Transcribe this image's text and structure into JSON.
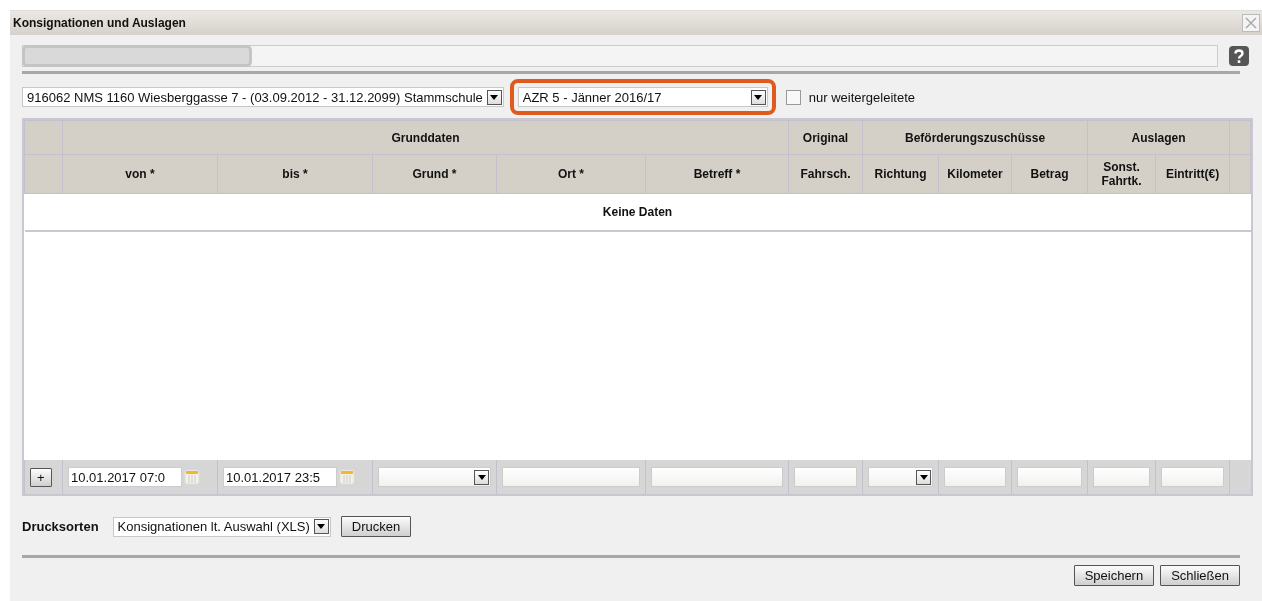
{
  "window": {
    "title": "Konsignationen und Auslagen"
  },
  "filters": {
    "school_select": {
      "value": "916062 NMS 1160 Wiesberggasse 7 - (03.09.2012 - 31.12.2099) Stammschule"
    },
    "period_select": {
      "value": "AZR 5 - Jänner 2016/17",
      "highlighted": true
    },
    "forwarded_checkbox": {
      "label": "nur weitergeleitete",
      "checked": false
    }
  },
  "table": {
    "groups": [
      "Grunddaten",
      "Original",
      "Beförderungszuschüsse",
      "Auslagen"
    ],
    "columns": [
      "von *",
      "bis *",
      "Grund *",
      "Ort *",
      "Betreff *",
      "Fahrsch.",
      "Richtung",
      "Kilometer",
      "Betrag",
      "Sonst. Fahrtk.",
      "Eintritt(€)"
    ],
    "empty_message": "Keine Daten",
    "add_button": "+",
    "input_row": [
      {
        "kind": "date",
        "value": "10.01.2017 07:0"
      },
      {
        "kind": "date",
        "value": "10.01.2017 23:5"
      },
      {
        "kind": "select"
      },
      {
        "kind": "text"
      },
      {
        "kind": "text"
      },
      {
        "kind": "text"
      },
      {
        "kind": "select"
      },
      {
        "kind": "text"
      },
      {
        "kind": "text"
      },
      {
        "kind": "text"
      },
      {
        "kind": "text"
      }
    ]
  },
  "print": {
    "label": "Drucksorten",
    "select": "Konsignationen lt. Auswahl (XLS)",
    "button": "Drucken"
  },
  "buttons": [
    "Speichern",
    "Schließen"
  ]
}
